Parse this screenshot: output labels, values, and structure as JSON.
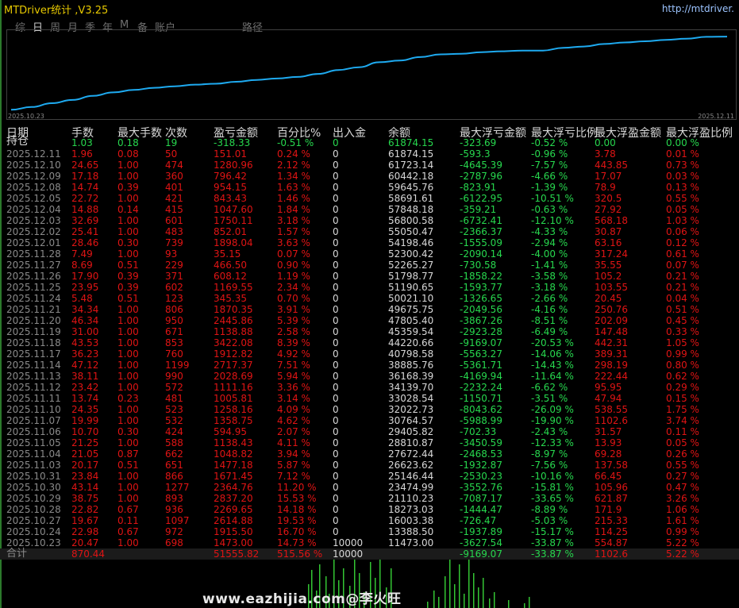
{
  "window": {
    "title": "MTDriver统计 ,V3.25",
    "url": "http://mtdriver."
  },
  "tabs": [
    "综",
    "日",
    "周",
    "月",
    "季",
    "年",
    "M",
    "备",
    "账户",
    "路径"
  ],
  "active_tab": 1,
  "equity_curve": {
    "x_start": "2025.10.23",
    "x_end": "2025.12.11",
    "values": [
      11473.0,
      13388.5,
      16003.38,
      18273.03,
      21110.23,
      23474.99,
      25146.44,
      26623.62,
      27672.44,
      28810.87,
      29405.82,
      30764.57,
      32022.73,
      33028.54,
      34139.7,
      36168.39,
      38885.76,
      40798.58,
      44220.66,
      45359.54,
      47805.4,
      49675.75,
      50021.1,
      51190.65,
      51798.77,
      52265.27,
      52300.42,
      54198.46,
      55050.47,
      56800.58,
      57848.18,
      58691.61,
      59645.76,
      60442.18,
      61723.14,
      61874.15
    ],
    "color": "#1eaaf0"
  },
  "headers": [
    "日期",
    "手数",
    "最大手数",
    "次数",
    "盈亏金额",
    "百分比%",
    "出入金",
    "余额",
    "最大浮亏金额",
    "最大浮亏比例",
    "最大浮盈金额",
    "最大浮盈比例"
  ],
  "holding": [
    "持仓",
    "1.03",
    "0.18",
    "19",
    "-318.33",
    "-0.51 %",
    "0",
    "61874.15",
    "-323.69",
    "-0.52 %",
    "0.00",
    "0.00 %"
  ],
  "rows": [
    [
      "2025.12.11",
      "1.96",
      "0.08",
      "50",
      "151.01",
      "0.24 %",
      "0",
      "61874.15",
      "-593.3",
      "-0.96 %",
      "3.78",
      "0.01 %"
    ],
    [
      "2025.12.10",
      "24.65",
      "1.00",
      "474",
      "1280.96",
      "2.12 %",
      "0",
      "61723.14",
      "-4645.39",
      "-7.57 %",
      "443.85",
      "0.73 %"
    ],
    [
      "2025.12.09",
      "17.18",
      "1.00",
      "360",
      "796.42",
      "1.34 %",
      "0",
      "60442.18",
      "-2787.96",
      "-4.66 %",
      "17.07",
      "0.03 %"
    ],
    [
      "2025.12.08",
      "14.74",
      "0.39",
      "401",
      "954.15",
      "1.63 %",
      "0",
      "59645.76",
      "-823.91",
      "-1.39 %",
      "78.9",
      "0.13 %"
    ],
    [
      "2025.12.05",
      "22.72",
      "1.00",
      "421",
      "843.43",
      "1.46 %",
      "0",
      "58691.61",
      "-6122.95",
      "-10.51 %",
      "320.5",
      "0.55 %"
    ],
    [
      "2025.12.04",
      "14.88",
      "0.14",
      "415",
      "1047.60",
      "1.84 %",
      "0",
      "57848.18",
      "-359.21",
      "-0.63 %",
      "27.92",
      "0.05 %"
    ],
    [
      "2025.12.03",
      "32.69",
      "1.00",
      "601",
      "1750.11",
      "3.18 %",
      "0",
      "56800.58",
      "-6732.41",
      "-12.10 %",
      "568.18",
      "1.03 %"
    ],
    [
      "2025.12.02",
      "25.41",
      "1.00",
      "483",
      "852.01",
      "1.57 %",
      "0",
      "55050.47",
      "-2366.37",
      "-4.33 %",
      "30.87",
      "0.06 %"
    ],
    [
      "2025.12.01",
      "28.46",
      "0.30",
      "739",
      "1898.04",
      "3.63 %",
      "0",
      "54198.46",
      "-1555.09",
      "-2.94 %",
      "63.16",
      "0.12 %"
    ],
    [
      "2025.11.28",
      "7.49",
      "1.00",
      "93",
      "35.15",
      "0.07 %",
      "0",
      "52300.42",
      "-2090.14",
      "-4.00 %",
      "317.24",
      "0.61 %"
    ],
    [
      "2025.11.27",
      "8.69",
      "0.51",
      "229",
      "466.50",
      "0.90 %",
      "0",
      "52265.27",
      "-730.58",
      "-1.41 %",
      "35.55",
      "0.07 %"
    ],
    [
      "2025.11.26",
      "17.90",
      "0.39",
      "371",
      "608.12",
      "1.19 %",
      "0",
      "51798.77",
      "-1858.22",
      "-3.58 %",
      "105.2",
      "0.21 %"
    ],
    [
      "2025.11.25",
      "23.95",
      "0.39",
      "602",
      "1169.55",
      "2.34 %",
      "0",
      "51190.65",
      "-1593.77",
      "-3.18 %",
      "103.55",
      "0.21 %"
    ],
    [
      "2025.11.24",
      "5.48",
      "0.51",
      "123",
      "345.35",
      "0.70 %",
      "0",
      "50021.10",
      "-1326.65",
      "-2.66 %",
      "20.45",
      "0.04 %"
    ],
    [
      "2025.11.21",
      "34.34",
      "1.00",
      "806",
      "1870.35",
      "3.91 %",
      "0",
      "49675.75",
      "-2049.56",
      "-4.16 %",
      "250.76",
      "0.51 %"
    ],
    [
      "2025.11.20",
      "46.34",
      "1.00",
      "950",
      "2445.86",
      "5.39 %",
      "0",
      "47805.40",
      "-3867.26",
      "-8.51 %",
      "202.09",
      "0.45 %"
    ],
    [
      "2025.11.19",
      "31.00",
      "1.00",
      "671",
      "1138.88",
      "2.58 %",
      "0",
      "45359.54",
      "-2923.28",
      "-6.49 %",
      "147.48",
      "0.33 %"
    ],
    [
      "2025.11.18",
      "43.53",
      "1.00",
      "853",
      "3422.08",
      "8.39 %",
      "0",
      "44220.66",
      "-9169.07",
      "-20.53 %",
      "442.31",
      "1.05 %"
    ],
    [
      "2025.11.17",
      "36.23",
      "1.00",
      "760",
      "1912.82",
      "4.92 %",
      "0",
      "40798.58",
      "-5563.27",
      "-14.06 %",
      "389.31",
      "0.99 %"
    ],
    [
      "2025.11.14",
      "47.12",
      "1.00",
      "1199",
      "2717.37",
      "7.51 %",
      "0",
      "38885.76",
      "-5361.71",
      "-14.43 %",
      "298.19",
      "0.80 %"
    ],
    [
      "2025.11.13",
      "38.11",
      "1.00",
      "990",
      "2028.69",
      "5.94 %",
      "0",
      "36168.39",
      "-4169.94",
      "-11.64 %",
      "222.44",
      "0.62 %"
    ],
    [
      "2025.11.12",
      "23.42",
      "1.00",
      "572",
      "1111.16",
      "3.36 %",
      "0",
      "34139.70",
      "-2232.24",
      "-6.62 %",
      "95.95",
      "0.29 %"
    ],
    [
      "2025.11.11",
      "13.74",
      "0.23",
      "481",
      "1005.81",
      "3.14 %",
      "0",
      "33028.54",
      "-1150.71",
      "-3.51 %",
      "47.94",
      "0.15 %"
    ],
    [
      "2025.11.10",
      "24.35",
      "1.00",
      "523",
      "1258.16",
      "4.09 %",
      "0",
      "32022.73",
      "-8043.62",
      "-26.09 %",
      "538.55",
      "1.75 %"
    ],
    [
      "2025.11.07",
      "19.99",
      "1.00",
      "532",
      "1358.75",
      "4.62 %",
      "0",
      "30764.57",
      "-5988.99",
      "-19.90 %",
      "1102.6",
      "3.74 %"
    ],
    [
      "2025.11.06",
      "10.70",
      "0.30",
      "424",
      "594.95",
      "2.07 %",
      "0",
      "29405.82",
      "-702.33",
      "-2.43 %",
      "31.57",
      "0.11 %"
    ],
    [
      "2025.11.05",
      "21.25",
      "1.00",
      "588",
      "1138.43",
      "4.11 %",
      "0",
      "28810.87",
      "-3450.59",
      "-12.33 %",
      "13.93",
      "0.05 %"
    ],
    [
      "2025.11.04",
      "21.05",
      "0.87",
      "662",
      "1048.82",
      "3.94 %",
      "0",
      "27672.44",
      "-2468.53",
      "-8.97 %",
      "69.28",
      "0.26 %"
    ],
    [
      "2025.11.03",
      "20.17",
      "0.51",
      "651",
      "1477.18",
      "5.87 %",
      "0",
      "26623.62",
      "-1932.87",
      "-7.56 %",
      "137.58",
      "0.55 %"
    ],
    [
      "2025.10.31",
      "23.84",
      "1.00",
      "866",
      "1671.45",
      "7.12 %",
      "0",
      "25146.44",
      "-2530.23",
      "-10.16 %",
      "66.45",
      "0.27 %"
    ],
    [
      "2025.10.30",
      "43.14",
      "1.00",
      "1277",
      "2364.76",
      "11.20 %",
      "0",
      "23474.99",
      "-3552.76",
      "-15.81 %",
      "105.96",
      "0.47 %"
    ],
    [
      "2025.10.29",
      "38.75",
      "1.00",
      "893",
      "2837.20",
      "15.53 %",
      "0",
      "21110.23",
      "-7087.17",
      "-33.65 %",
      "621.87",
      "3.26 %"
    ],
    [
      "2025.10.28",
      "22.82",
      "0.67",
      "936",
      "2269.65",
      "14.18 %",
      "0",
      "18273.03",
      "-1444.47",
      "-8.89 %",
      "171.9",
      "1.06 %"
    ],
    [
      "2025.10.27",
      "19.67",
      "0.11",
      "1097",
      "2614.88",
      "19.53 %",
      "0",
      "16003.38",
      "-726.47",
      "-5.03 %",
      "215.33",
      "1.61 %"
    ],
    [
      "2025.10.24",
      "22.98",
      "0.67",
      "972",
      "1915.50",
      "16.70 %",
      "0",
      "13388.50",
      "-1937.89",
      "-15.17 %",
      "114.25",
      "0.99 %"
    ],
    [
      "2025.10.23",
      "20.47",
      "1.00",
      "698",
      "1473.00",
      "14.73 %",
      "10000",
      "11473.00",
      "-3627.54",
      "-33.87 %",
      "554.87",
      "5.22 %"
    ]
  ],
  "total": [
    "合计",
    "870.44",
    "",
    "",
    "51555.82",
    "515.56 %",
    "10000",
    "",
    "-9169.07",
    "-33.87 %",
    "1102.6",
    "5.22 %"
  ],
  "watermark": "www.eazhijia.com@李火旺"
}
